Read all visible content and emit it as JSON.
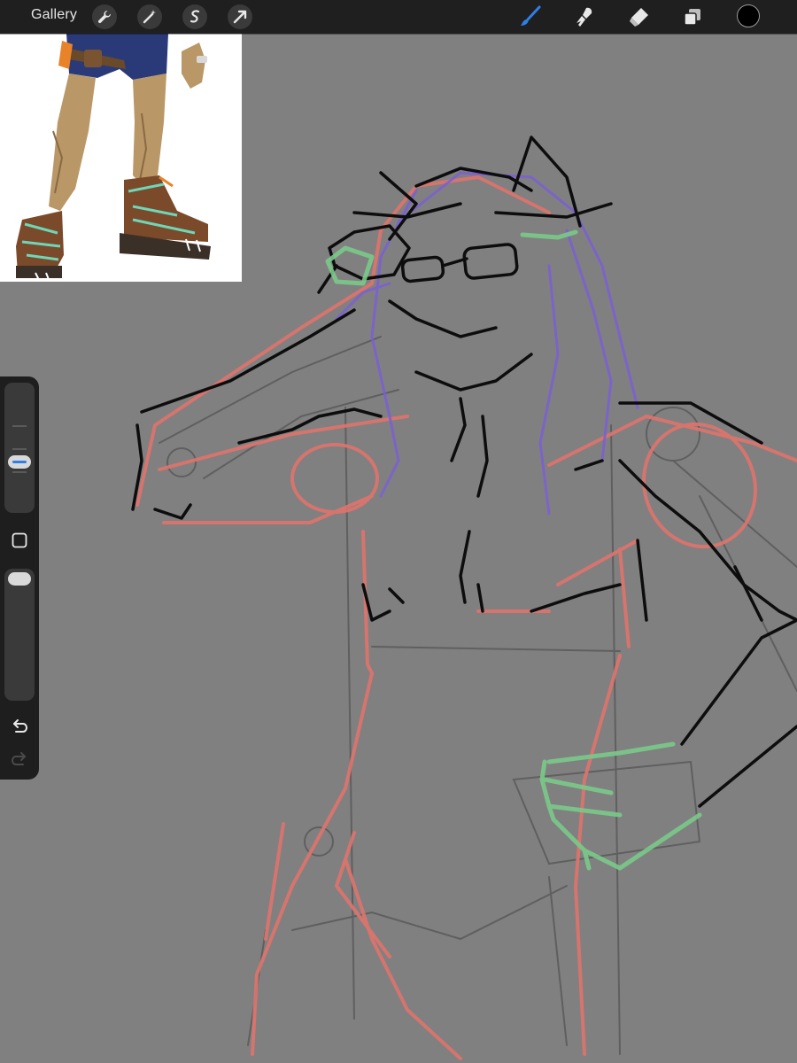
{
  "toolbar": {
    "gallery_label": "Gallery",
    "left_tools": [
      "wrench-icon",
      "magic-wand-icon",
      "selection-icon",
      "transform-arrow-icon"
    ],
    "right_tools": [
      "brush-icon",
      "smudge-icon",
      "eraser-icon",
      "layers-icon"
    ],
    "active_tool": "brush-icon",
    "current_color": "#000000",
    "accent_color": "#2f7fe6"
  },
  "sidebar": {
    "brush_size_level": 0.68,
    "opacity_level": 1.0,
    "icons": [
      "modify-square-icon",
      "undo-icon",
      "redo-icon"
    ]
  },
  "sketch_colors": {
    "construction": "#4a4a4a",
    "red_layer": "#e0736d",
    "ink": "#0d0d0d",
    "purple": "#7b5fd6",
    "green": "#7ac98a"
  }
}
